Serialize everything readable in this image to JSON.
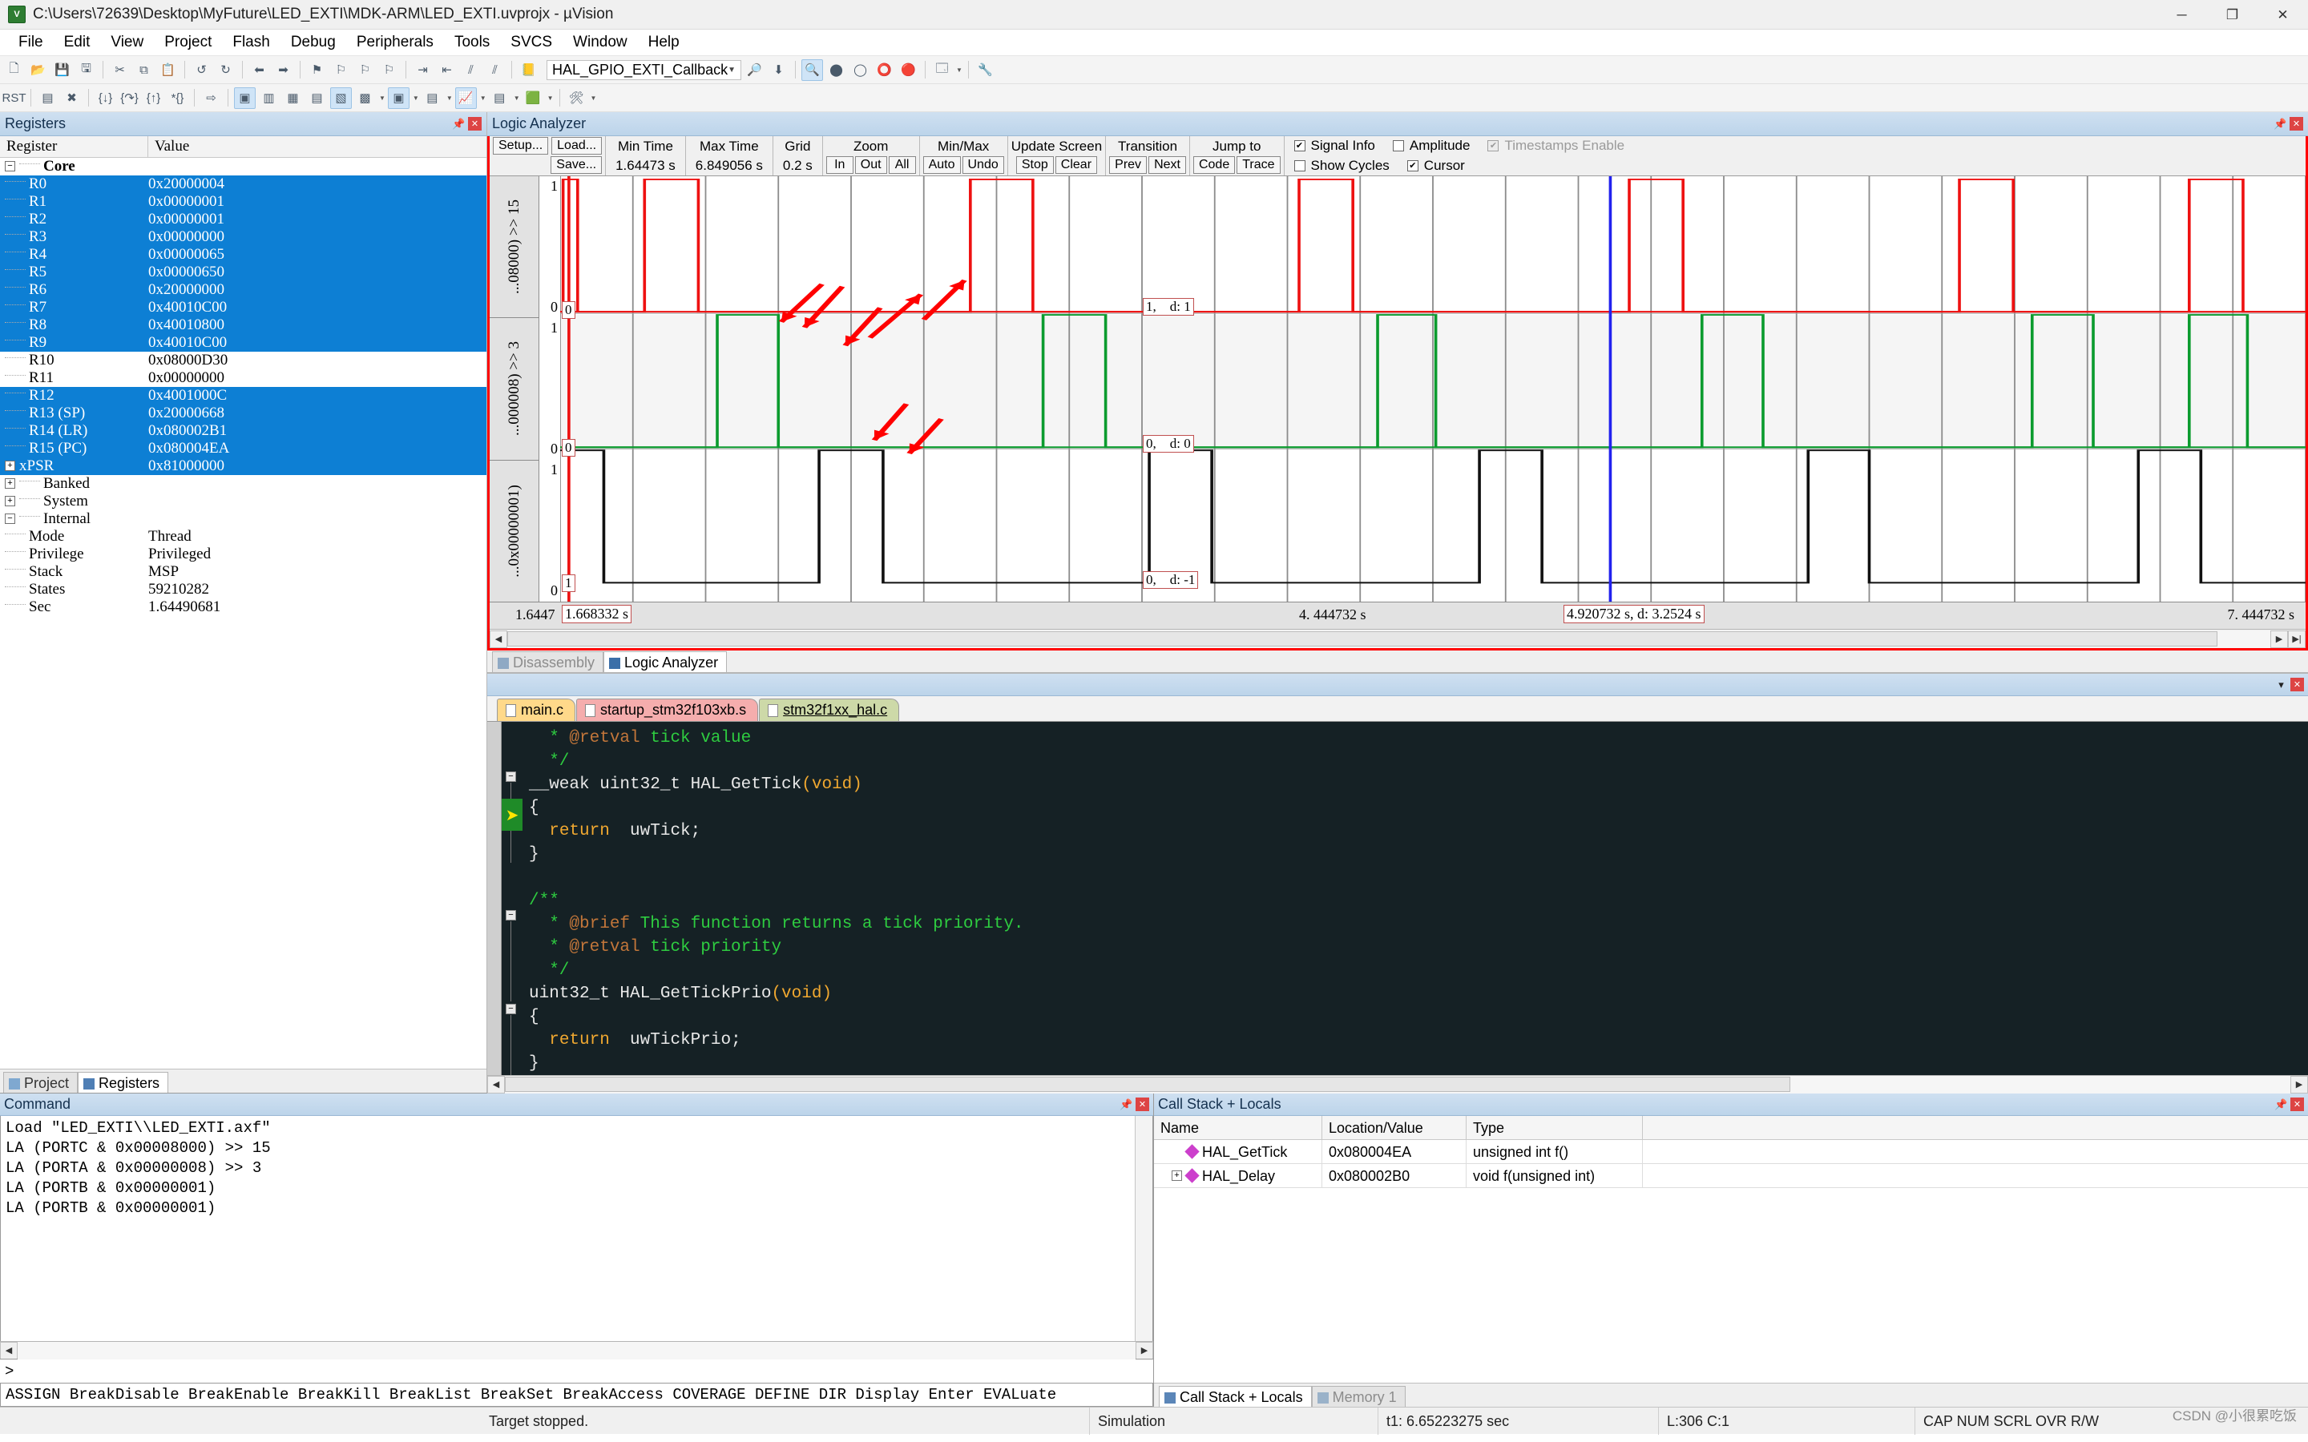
{
  "window": {
    "title": "C:\\Users\\72639\\Desktop\\MyFuture\\LED_EXTI\\MDK-ARM\\LED_EXTI.uvprojx - µVision",
    "app_icon": "uvision-logo-icon",
    "minimize": "─",
    "maximize": "❐",
    "close": "✕"
  },
  "menu": [
    "File",
    "Edit",
    "View",
    "Project",
    "Flash",
    "Debug",
    "Peripherals",
    "Tools",
    "SVCS",
    "Window",
    "Help"
  ],
  "toolbar": {
    "function_combo": "HAL_GPIO_EXTI_Callback"
  },
  "registers": {
    "panel_title": "Registers",
    "col_register": "Register",
    "col_value": "Value",
    "group_core": "Core",
    "rows": [
      {
        "name": "R0",
        "value": "0x20000004",
        "sel": true
      },
      {
        "name": "R1",
        "value": "0x00000001",
        "sel": true
      },
      {
        "name": "R2",
        "value": "0x00000001",
        "sel": true
      },
      {
        "name": "R3",
        "value": "0x00000000",
        "sel": true
      },
      {
        "name": "R4",
        "value": "0x00000065",
        "sel": true
      },
      {
        "name": "R5",
        "value": "0x00000650",
        "sel": true
      },
      {
        "name": "R6",
        "value": "0x20000000",
        "sel": true
      },
      {
        "name": "R7",
        "value": "0x40010C00",
        "sel": true
      },
      {
        "name": "R8",
        "value": "0x40010800",
        "sel": true
      },
      {
        "name": "R9",
        "value": "0x40010C00",
        "sel": true
      },
      {
        "name": "R10",
        "value": "0x08000D30",
        "sel": false
      },
      {
        "name": "R11",
        "value": "0x00000000",
        "sel": false
      },
      {
        "name": "R12",
        "value": "0x4001000C",
        "sel": true
      },
      {
        "name": "R13 (SP)",
        "value": "0x20000668",
        "sel": true
      },
      {
        "name": "R14 (LR)",
        "value": "0x080002B1",
        "sel": true
      },
      {
        "name": "R15 (PC)",
        "value": "0x080004EA",
        "sel": true
      },
      {
        "name": "xPSR",
        "value": "0x81000000",
        "sel": true,
        "expand": "+"
      }
    ],
    "group_banked": "Banked",
    "group_system": "System",
    "group_internal": "Internal",
    "internal_rows": [
      {
        "name": "Mode",
        "value": "Thread"
      },
      {
        "name": "Privilege",
        "value": "Privileged"
      },
      {
        "name": "Stack",
        "value": "MSP"
      },
      {
        "name": "States",
        "value": "59210282"
      },
      {
        "name": "Sec",
        "value": "1.64490681"
      }
    ],
    "tabs": [
      {
        "label": "Project",
        "active": false,
        "icon": "project-icon"
      },
      {
        "label": "Registers",
        "active": true,
        "icon": "registers-icon"
      }
    ]
  },
  "logic_analyzer": {
    "panel_title": "Logic Analyzer",
    "buttons": {
      "setup": "Setup...",
      "load": "Load...",
      "save": "Save..."
    },
    "fields": [
      {
        "label": "Min Time",
        "value": "1.64473 s"
      },
      {
        "label": "Max Time",
        "value": "6.849056 s"
      },
      {
        "label": "Grid",
        "value": "0.2 s"
      }
    ],
    "zoom": {
      "label": "Zoom",
      "buttons": [
        "In",
        "Out",
        "All"
      ]
    },
    "minmax": {
      "label": "Min/Max",
      "buttons": [
        "Auto",
        "Undo"
      ]
    },
    "update_screen": {
      "label": "Update Screen",
      "buttons": [
        "Stop",
        "Clear"
      ]
    },
    "transition": {
      "label": "Transition",
      "buttons": [
        "Prev",
        "Next"
      ]
    },
    "jump_to": {
      "label": "Jump to",
      "buttons": [
        "Code",
        "Trace"
      ]
    },
    "checkboxes": [
      {
        "label": "Signal Info",
        "checked": true,
        "disabled": false
      },
      {
        "label": "Amplitude",
        "checked": false,
        "disabled": false
      },
      {
        "label": "Timestamps Enable",
        "checked": true,
        "disabled": true
      },
      {
        "label": "Show Cycles",
        "checked": false,
        "disabled": false
      },
      {
        "label": "Cursor",
        "checked": true,
        "disabled": false
      }
    ],
    "signals": [
      {
        "label": "...08000) >> 15",
        "color": "#ee1111",
        "y_hi": "1",
        "y_lo": "0",
        "left_tag": "0",
        "cursor_tag": "1,    d: 1"
      },
      {
        "label": "...000008) >> 3",
        "color": "#0b9b2e",
        "y_hi": "1",
        "y_lo": "0",
        "left_tag": "0",
        "cursor_tag": "0,    d: 0"
      },
      {
        "label": "...0x00000001)",
        "color": "#111111",
        "y_hi": "1",
        "y_lo": "0",
        "left_tag": "1",
        "cursor_tag": "0,    d: -1"
      }
    ],
    "time_axis": {
      "start": "1.6447",
      "cursor_left": "1.668332 s",
      "mid": "4. 444732  s",
      "cursor_box": "4.920732 s,   d: 3.2524 s",
      "end": "7. 444732  s"
    },
    "tabs": [
      {
        "label": "Disassembly",
        "active": false,
        "icon": "disassembly-icon"
      },
      {
        "label": "Logic Analyzer",
        "active": true,
        "icon": "logic-analyzer-icon"
      }
    ]
  },
  "editor": {
    "tabs": [
      {
        "label": "main.c",
        "active": false
      },
      {
        "label": "startup_stm32f103xb.s",
        "active": false
      },
      {
        "label": "stm32f1xx_hal.c",
        "active": true
      }
    ],
    "code_lines": [
      [
        {
          "t": "  * ",
          "c": "com"
        },
        {
          "t": "@retval",
          "c": "tag"
        },
        {
          "t": " tick value",
          "c": "com"
        }
      ],
      [
        {
          "t": "  */",
          "c": "com"
        }
      ],
      [
        {
          "t": "__weak uint32_t HAL_GetTick",
          "c": "pl"
        },
        {
          "t": "(void)",
          "c": "par"
        }
      ],
      [
        {
          "t": "{",
          "c": "pl"
        }
      ],
      [
        {
          "t": "  ",
          "c": "pl"
        },
        {
          "t": "return",
          "c": "kw"
        },
        {
          "t": "  uwTick;",
          "c": "pl"
        }
      ],
      [
        {
          "t": "}",
          "c": "pl"
        }
      ],
      [
        {
          "t": "",
          "c": "pl"
        }
      ],
      [
        {
          "t": "/**",
          "c": "com"
        }
      ],
      [
        {
          "t": "  * ",
          "c": "com"
        },
        {
          "t": "@brief",
          "c": "tag"
        },
        {
          "t": " This function returns a tick priority.",
          "c": "com"
        }
      ],
      [
        {
          "t": "  * ",
          "c": "com"
        },
        {
          "t": "@retval",
          "c": "tag"
        },
        {
          "t": " tick priority",
          "c": "com"
        }
      ],
      [
        {
          "t": "  */",
          "c": "com"
        }
      ],
      [
        {
          "t": "uint32_t HAL_GetTickPrio",
          "c": "pl"
        },
        {
          "t": "(void)",
          "c": "par"
        }
      ],
      [
        {
          "t": "{",
          "c": "pl"
        }
      ],
      [
        {
          "t": "  ",
          "c": "pl"
        },
        {
          "t": "return",
          "c": "kw"
        },
        {
          "t": "  uwTickPrio;",
          "c": "pl"
        }
      ],
      [
        {
          "t": "}",
          "c": "pl"
        }
      ]
    ]
  },
  "command": {
    "panel_title": "Command",
    "lines": [
      "Load \"LED_EXTI\\\\LED_EXTI.axf\"",
      "LA (PORTC & 0x00008000) >> 15",
      "LA (PORTA & 0x00000008) >> 3",
      "LA (PORTB & 0x00000001)",
      "LA (PORTB & 0x00000001)"
    ],
    "prompt": ">",
    "help_text": "ASSIGN BreakDisable BreakEnable BreakKill BreakList BreakSet BreakAccess COVERAGE DEFINE DIR Display Enter EVALuate"
  },
  "call_stack": {
    "panel_title": "Call Stack + Locals",
    "columns": [
      "Name",
      "Location/Value",
      "Type"
    ],
    "rows": [
      {
        "name": "HAL_GetTick",
        "location": "0x080004EA",
        "type": "unsigned int f()",
        "expandable": false
      },
      {
        "name": "HAL_Delay",
        "location": "0x080002B0",
        "type": "void f(unsigned int)",
        "expandable": true
      }
    ],
    "tabs": [
      {
        "label": "Call Stack + Locals",
        "active": true,
        "icon": "call-stack-icon"
      },
      {
        "label": "Memory 1",
        "active": false,
        "icon": "memory-icon"
      }
    ]
  },
  "status_bar": {
    "target": "Target stopped.",
    "mode": "Simulation",
    "time": "t1: 6.65223275 sec",
    "position": "L:306 C:1",
    "indicators": "CAP NUM SCRL OVR R/W",
    "watermark": "CSDN @小很累吃饭"
  },
  "colors": {
    "accent_selection": "#0d7fd4",
    "la_border": "#ff0000",
    "signal_red": "#ee1111",
    "signal_green": "#0b9b2e",
    "signal_black": "#111111",
    "cursor_blue": "#2222ee",
    "editor_bg": "#152125"
  }
}
